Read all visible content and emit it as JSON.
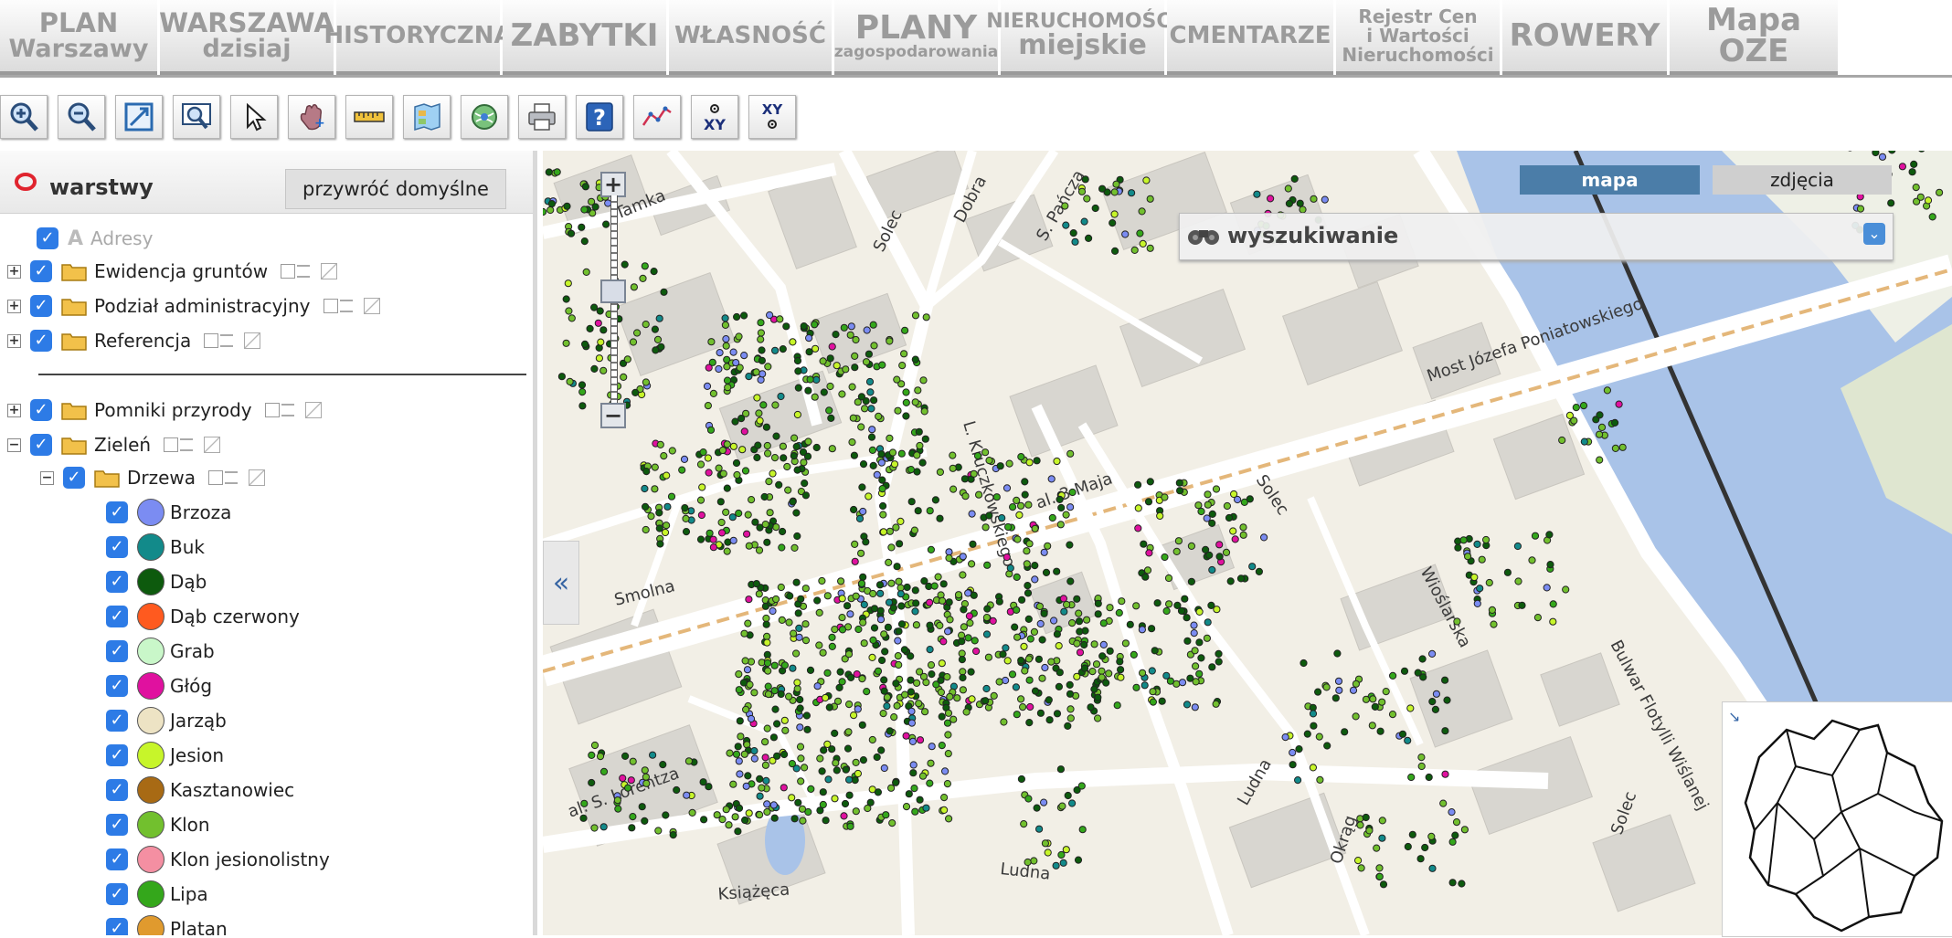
{
  "tabs": [
    {
      "id": "plan",
      "lines": [
        "PLAN",
        "Warszawy"
      ]
    },
    {
      "id": "warszawa",
      "lines": [
        "WARSZAWA",
        "dzisiaj"
      ]
    },
    {
      "id": "historyczna",
      "lines": [
        "HISTORYCZNA"
      ]
    },
    {
      "id": "zabytki",
      "lines": [
        "ZABYTKI"
      ]
    },
    {
      "id": "wlasnosc",
      "lines": [
        "WŁASNOŚĆ"
      ]
    },
    {
      "id": "plany",
      "lines": [
        "PLANY",
        "zagospodarowania"
      ]
    },
    {
      "id": "nieruchomosci",
      "lines": [
        "NIERUCHOMOŚCI",
        "miejskie"
      ]
    },
    {
      "id": "cmentarze",
      "lines": [
        "CMENTARZE"
      ]
    },
    {
      "id": "rejestr",
      "lines": [
        "Rejestr Cen",
        "i Wartości",
        "Nieruchomości"
      ]
    },
    {
      "id": "rowery",
      "lines": [
        "ROWERY"
      ]
    },
    {
      "id": "oze",
      "lines": [
        "Mapa OZE"
      ]
    }
  ],
  "toolbar": [
    "zoom-in-icon",
    "zoom-out-icon",
    "full-extent-icon",
    "zoom-window-icon",
    "select-pointer-icon",
    "pan-hand-icon",
    "measure-icon",
    "map-legend-icon",
    "globe-icon",
    "print-icon",
    "help-icon",
    "profile-line-icon",
    "xy-coordinates-icon",
    "xy-locate-icon"
  ],
  "panel": {
    "title": "warstwy",
    "restore_label": "przywróć domyślne",
    "layers": [
      {
        "label": "Adresy",
        "greyed": true
      },
      {
        "label": "Ewidencja gruntów",
        "expand": "+"
      },
      {
        "label": "Podział administracyjny",
        "expand": "+"
      },
      {
        "label": "Referencja",
        "expand": "+"
      },
      {
        "label": "Pomniki przyrody",
        "expand": "+"
      },
      {
        "label": "Zieleń",
        "expand": "−"
      },
      {
        "label": "Drzewa",
        "expand": "−"
      }
    ],
    "species": [
      {
        "label": "Brzoza",
        "color": "#7b8cf2"
      },
      {
        "label": "Buk",
        "color": "#128a8a"
      },
      {
        "label": "Dąb",
        "color": "#0d5a0d"
      },
      {
        "label": "Dąb czerwony",
        "color": "#ff5a1f"
      },
      {
        "label": "Grab",
        "color": "#c9f7c9"
      },
      {
        "label": "Głóg",
        "color": "#e0119f"
      },
      {
        "label": "Jarząb",
        "color": "#ede3c4"
      },
      {
        "label": "Jesion",
        "color": "#c7f52a"
      },
      {
        "label": "Kasztanowiec",
        "color": "#a86a14"
      },
      {
        "label": "Klon",
        "color": "#72c02e"
      },
      {
        "label": "Klon jesionolistny",
        "color": "#f48fa2"
      },
      {
        "label": "Lipa",
        "color": "#34a71b"
      },
      {
        "label": "Platan",
        "color": "#e09a2e"
      }
    ]
  },
  "map": {
    "mode_map": "mapa",
    "mode_photos": "zdjęcia",
    "search_title": "wyszukiwanie",
    "zoom_in": "+",
    "zoom_out": "−",
    "collapse": "«",
    "streets": {
      "tamka": "Tamka",
      "solec1": "Solec",
      "dobra": "Dobra",
      "pancza": "S. Pańcza",
      "poniatowskiego": "Most Józefa Poniatowskiego",
      "kruczkowskiego": "L. Kruczkowskiego",
      "maja": "al. 3 Maja",
      "smolna": "Smolna",
      "solec2": "Solec",
      "wioslarska": "Wioślarska",
      "bulwar": "Bulwar Flotylli Wiślanej",
      "lorentza": "al. S. Lorentza",
      "ludna1": "Ludna",
      "ludna2": "Ludna",
      "okrag": "Okrąg",
      "ksiazeca": "Książęca",
      "solec3": "Solec"
    }
  }
}
